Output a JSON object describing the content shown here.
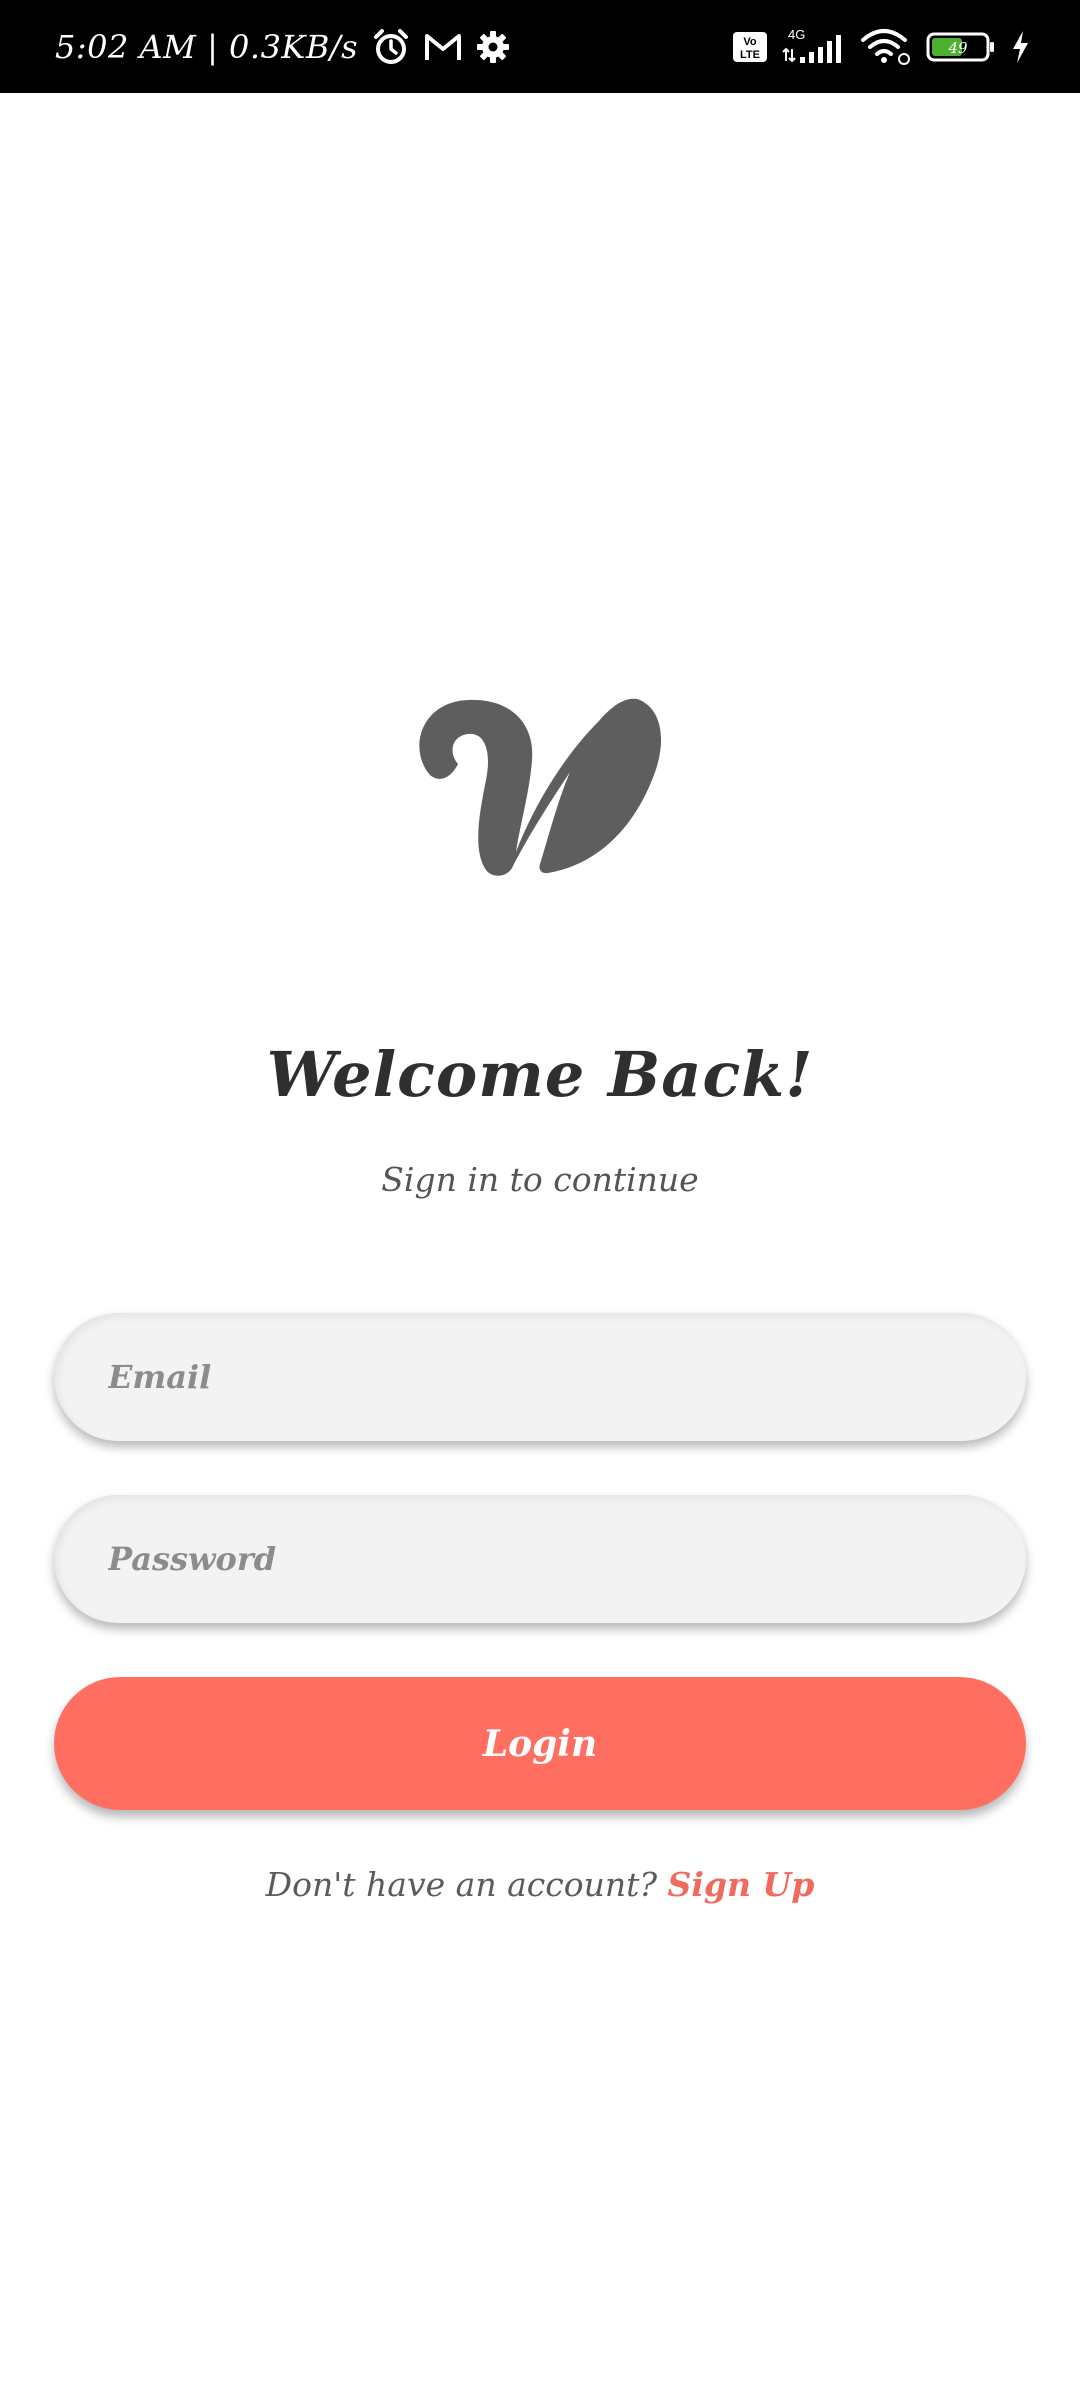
{
  "status_bar": {
    "time_speed": "5:02 AM | 0.3KB/s",
    "network": "4G",
    "volte": "Vo LTE",
    "battery_level": "49"
  },
  "login": {
    "title": "Welcome Back!",
    "subtitle": "Sign in to continue",
    "email_placeholder": "Email",
    "password_placeholder": "Password",
    "login_label": "Login",
    "no_account_text": "Don't have an account?",
    "signup_label": "Sign Up"
  },
  "colors": {
    "accent": "#ff6f61",
    "title": "#2f2f2f",
    "field_bg": "#f3f3f3",
    "logo": "#5e5e5e"
  },
  "icons": {
    "status": [
      "alarm-icon",
      "gmail-icon",
      "settings-icon",
      "volte-icon",
      "signal-icon",
      "wifi-icon",
      "battery-icon",
      "charging-icon"
    ],
    "logo": "w-logo-icon"
  }
}
